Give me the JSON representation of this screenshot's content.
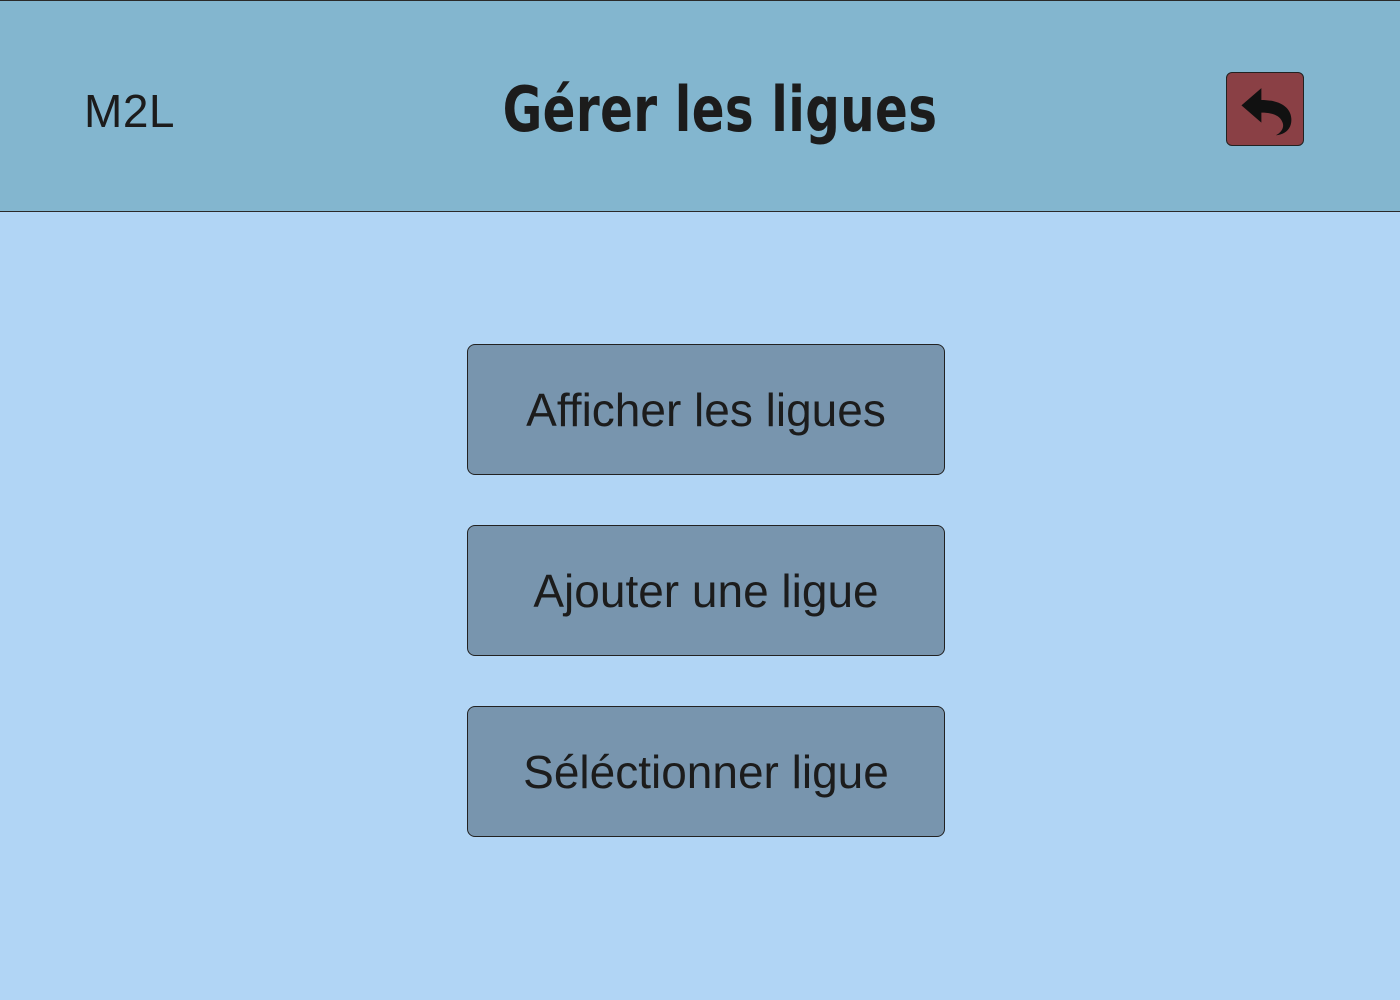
{
  "header": {
    "brand": "M2L",
    "title": "Gérer les ligues",
    "back_icon": "undo-arrow-icon"
  },
  "menu": {
    "buttons": [
      {
        "label": "Afficher les ligues"
      },
      {
        "label": "Ajouter une ligue"
      },
      {
        "label": "Séléctionner ligue"
      }
    ]
  },
  "colors": {
    "header_bg": "#83b6cf",
    "page_bg": "#b1d5f5",
    "button_bg": "#7895ae",
    "back_button_bg": "#8a4045"
  }
}
